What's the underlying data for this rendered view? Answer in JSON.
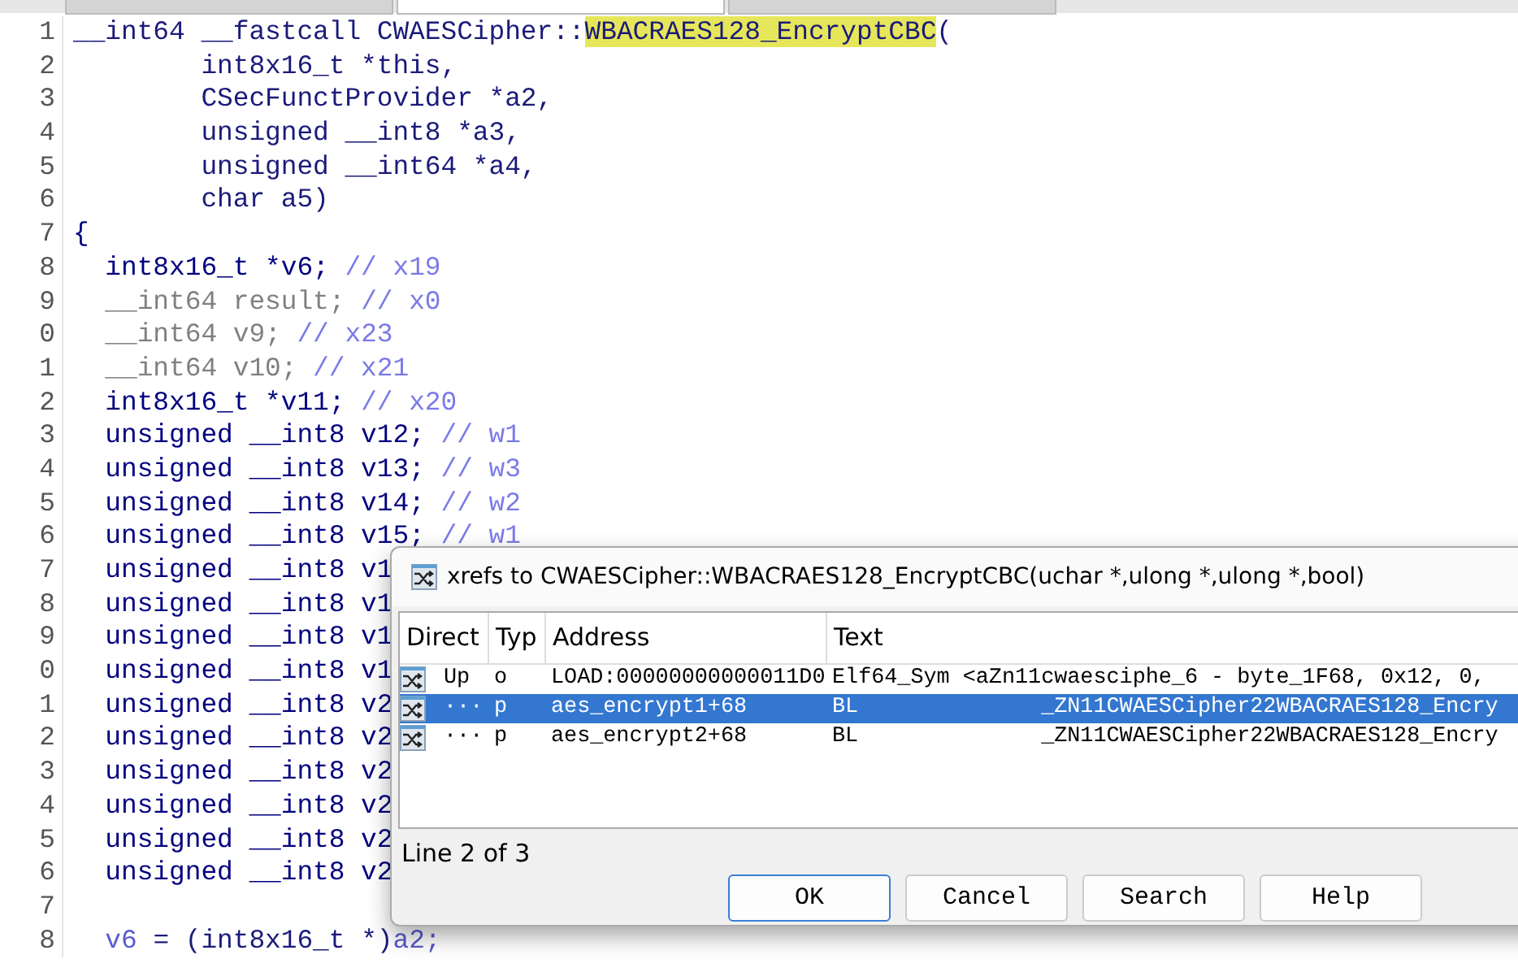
{
  "tabs": [
    {
      "selected": false
    },
    {
      "selected": true
    },
    {
      "selected": false
    }
  ],
  "code": {
    "lines": [
      {
        "number": "1",
        "tokens": [
          {
            "text": "__int64 __fastcall CWAESCipher::",
            "kind": "code"
          },
          {
            "text": "WBACRAES128_EncryptCBC",
            "kind": "highlight"
          },
          {
            "text": "(",
            "kind": "code"
          }
        ]
      },
      {
        "number": "2",
        "tokens": [
          {
            "text": "        int8x16_t *this,",
            "kind": "code"
          }
        ]
      },
      {
        "number": "3",
        "tokens": [
          {
            "text": "        CSecFunctProvider *a2,",
            "kind": "code"
          }
        ]
      },
      {
        "number": "4",
        "tokens": [
          {
            "text": "        unsigned __int8 *a3,",
            "kind": "code"
          }
        ]
      },
      {
        "number": "5",
        "tokens": [
          {
            "text": "        unsigned __int64 *a4,",
            "kind": "code"
          }
        ]
      },
      {
        "number": "6",
        "tokens": [
          {
            "text": "        char a5)",
            "kind": "code"
          }
        ]
      },
      {
        "number": "7",
        "tokens": [
          {
            "text": "{",
            "kind": "keyword"
          }
        ]
      },
      {
        "number": "8",
        "tokens": [
          {
            "text": "  int8x16_t *v6; ",
            "kind": "keyword"
          },
          {
            "text": "// x19",
            "kind": "comment"
          }
        ]
      },
      {
        "number": "9",
        "tokens": [
          {
            "text": "  __int64 result; ",
            "kind": "dim"
          },
          {
            "text": "// x0",
            "kind": "comment"
          }
        ]
      },
      {
        "number": "0",
        "tokens": [
          {
            "text": "  __int64 v9; ",
            "kind": "dim"
          },
          {
            "text": "// x23",
            "kind": "comment"
          }
        ]
      },
      {
        "number": "1",
        "tokens": [
          {
            "text": "  __int64 v10; ",
            "kind": "dim"
          },
          {
            "text": "// x21",
            "kind": "comment"
          }
        ]
      },
      {
        "number": "2",
        "tokens": [
          {
            "text": "  int8x16_t *v11; ",
            "kind": "keyword"
          },
          {
            "text": "// x20",
            "kind": "comment"
          }
        ]
      },
      {
        "number": "3",
        "tokens": [
          {
            "text": "  unsigned __int8 v12; ",
            "kind": "keyword"
          },
          {
            "text": "// w1",
            "kind": "comment"
          }
        ]
      },
      {
        "number": "4",
        "tokens": [
          {
            "text": "  unsigned __int8 v13; ",
            "kind": "keyword"
          },
          {
            "text": "// w3",
            "kind": "comment"
          }
        ]
      },
      {
        "number": "5",
        "tokens": [
          {
            "text": "  unsigned __int8 v14; ",
            "kind": "keyword"
          },
          {
            "text": "// w2",
            "kind": "comment"
          }
        ]
      },
      {
        "number": "6",
        "tokens": [
          {
            "text": "  unsigned __int8 v15; ",
            "kind": "keyword"
          },
          {
            "text": "// w1",
            "kind": "comment"
          }
        ]
      },
      {
        "number": "7",
        "tokens": [
          {
            "text": "  unsigned __int8 v1",
            "kind": "keyword"
          }
        ]
      },
      {
        "number": "8",
        "tokens": [
          {
            "text": "  unsigned __int8 v1",
            "kind": "keyword"
          }
        ]
      },
      {
        "number": "9",
        "tokens": [
          {
            "text": "  unsigned __int8 v1",
            "kind": "keyword"
          }
        ]
      },
      {
        "number": "0",
        "tokens": [
          {
            "text": "  unsigned __int8 v1",
            "kind": "keyword"
          }
        ]
      },
      {
        "number": "1",
        "tokens": [
          {
            "text": "  unsigned __int8 v2",
            "kind": "keyword"
          }
        ]
      },
      {
        "number": "2",
        "tokens": [
          {
            "text": "  unsigned __int8 v2",
            "kind": "keyword"
          }
        ]
      },
      {
        "number": "3",
        "tokens": [
          {
            "text": "  unsigned __int8 v2",
            "kind": "keyword"
          }
        ]
      },
      {
        "number": "4",
        "tokens": [
          {
            "text": "  unsigned __int8 v2",
            "kind": "keyword"
          }
        ]
      },
      {
        "number": "5",
        "tokens": [
          {
            "text": "  unsigned __int8 v2",
            "kind": "keyword"
          }
        ]
      },
      {
        "number": "6",
        "tokens": [
          {
            "text": "  unsigned __int8 v2",
            "kind": "keyword"
          }
        ]
      },
      {
        "number": "7"
      },
      {
        "number": "8",
        "tokens": [
          {
            "text": "  v6",
            "kind": "var"
          },
          {
            "text": " = (int8x16_t *)",
            "kind": "code"
          },
          {
            "text": "a2;",
            "kind": "var"
          }
        ]
      }
    ]
  },
  "dialog": {
    "title": "xrefs to CWAESCipher::WBACRAES128_EncryptCBC(uchar *,ulong *,ulong *,bool)",
    "columns": [
      "Direct",
      "Typ",
      "Address",
      "Text"
    ],
    "rows": [
      {
        "direction": "Up",
        "type": "o",
        "address": "LOAD:00000000000011D0",
        "text": "Elf64_Sym <aZn11cwaesciphe_6 - byte_1F68, 0x12, 0,",
        "selected": false
      },
      {
        "direction": "···",
        "type": "p",
        "address": "aes_encrypt1+68",
        "text": "BL              _ZN11CWAESCipher22WBACRAES128_Encry",
        "selected": true
      },
      {
        "direction": "···",
        "type": "p",
        "address": "aes_encrypt2+68",
        "text": "BL              _ZN11CWAESCipher22WBACRAES128_Encry",
        "selected": false
      }
    ],
    "status": "Line 2 of 3",
    "buttons": [
      {
        "label": "OK",
        "default": true
      },
      {
        "label": "Cancel",
        "default": false
      },
      {
        "label": "Search",
        "default": false
      },
      {
        "label": "Help",
        "default": false
      }
    ]
  }
}
